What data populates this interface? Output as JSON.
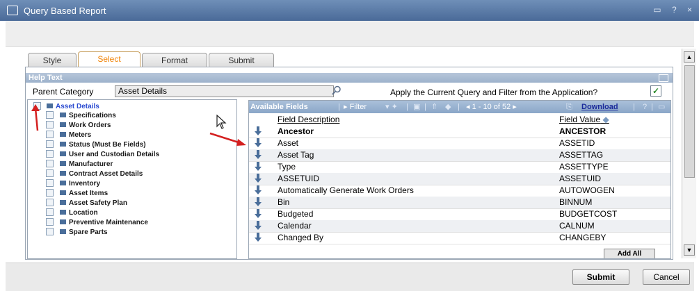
{
  "window": {
    "title": "Query Based Report",
    "controls": [
      "▭",
      "?",
      "×"
    ]
  },
  "tabs": [
    {
      "label": "Style",
      "active": false
    },
    {
      "label": "Select",
      "active": true
    },
    {
      "label": "Format",
      "active": false
    },
    {
      "label": "Submit",
      "active": false
    }
  ],
  "help": {
    "label": "Help Text"
  },
  "parent_category": {
    "label": "Parent Category",
    "value": "Asset Details"
  },
  "apply": {
    "label": "Apply the Current Query and Filter from the Application?",
    "checked": true,
    "check_glyph": "✓"
  },
  "tree": {
    "root": "Asset Details",
    "items": [
      "Specifications",
      "Work Orders",
      "Meters",
      "Status (Must Be Fields)",
      "User and Custodian Details",
      "Manufacturer",
      "Contract Asset Details",
      "Inventory",
      "Asset Items",
      "Asset Safety Plan",
      "Location",
      "Preventive Maintenance",
      "Spare Parts"
    ]
  },
  "fields": {
    "title": "Available Fields",
    "filter_label": "Filter",
    "pager": "1 - 10 of 52",
    "download": "Download",
    "help_glyph": "?",
    "col_desc": "Field Description",
    "col_value": "Field Value",
    "rows": [
      {
        "desc": "Ancestor",
        "value": "ANCESTOR",
        "bold": true
      },
      {
        "desc": "Asset",
        "value": "ASSETID"
      },
      {
        "desc": "Asset Tag",
        "value": "ASSETTAG"
      },
      {
        "desc": "Type",
        "value": "ASSETTYPE"
      },
      {
        "desc": "ASSETUID",
        "value": "ASSETUID"
      },
      {
        "desc": "Automatically Generate Work Orders",
        "value": "AUTOWOGEN"
      },
      {
        "desc": "Bin",
        "value": "BINNUM"
      },
      {
        "desc": "Budgeted",
        "value": "BUDGETCOST"
      },
      {
        "desc": "Calendar",
        "value": "CALNUM"
      },
      {
        "desc": "Changed By",
        "value": "CHANGEBY"
      }
    ],
    "add_all": "Add All"
  },
  "footer": {
    "submit": "Submit",
    "cancel": "Cancel"
  },
  "colors": {
    "accent_tab": "#f08000",
    "header_blue": "#8aa6c8",
    "annotation_red": "#d42020"
  }
}
